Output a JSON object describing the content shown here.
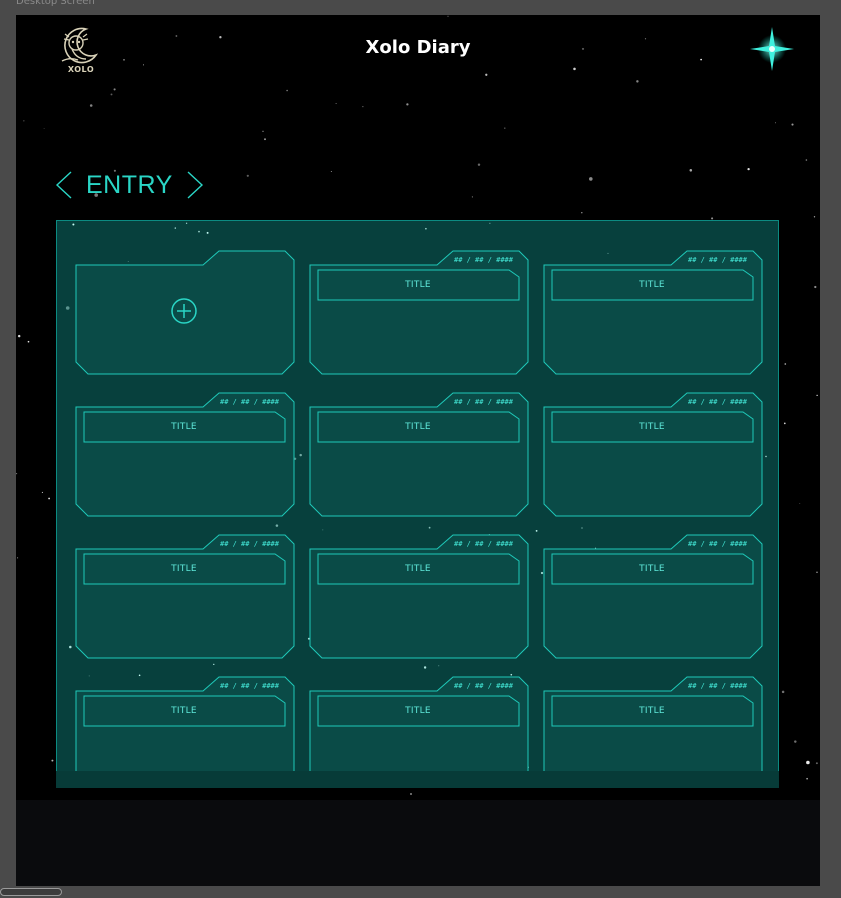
{
  "frame": {
    "label": "Desktop Screen"
  },
  "header": {
    "logo_text": "XOLO",
    "title": "Xolo Diary",
    "logo_icon": "axolotl-moon-logo",
    "sparkle_icon": "four-point-star-icon"
  },
  "section": {
    "title": "ENTRY",
    "prev_icon": "chevron-left-icon",
    "next_icon": "chevron-right-icon"
  },
  "new_entry": {
    "icon": "plus-circle-icon"
  },
  "entries": [
    {
      "date": "## / ## / ####",
      "title": "TITLE"
    },
    {
      "date": "## / ## / ####",
      "title": "TITLE"
    },
    {
      "date": "## / ## / ####",
      "title": "TITLE"
    },
    {
      "date": "## / ## / ####",
      "title": "TITLE"
    },
    {
      "date": "## / ## / ####",
      "title": "TITLE"
    },
    {
      "date": "## / ## / ####",
      "title": "TITLE"
    },
    {
      "date": "## / ## / ####",
      "title": "TITLE"
    },
    {
      "date": "## / ## / ####",
      "title": "TITLE"
    },
    {
      "date": "## / ## / ####",
      "title": "TITLE"
    },
    {
      "date": "## / ## / ####",
      "title": "TITLE"
    },
    {
      "date": "## / ## / ####",
      "title": "TITLE"
    }
  ],
  "colors": {
    "accent": "#2ad6c6",
    "panel": "#07403d",
    "card": "#0a4b47",
    "card_border": "#1fc9b9",
    "background": "#000000"
  }
}
